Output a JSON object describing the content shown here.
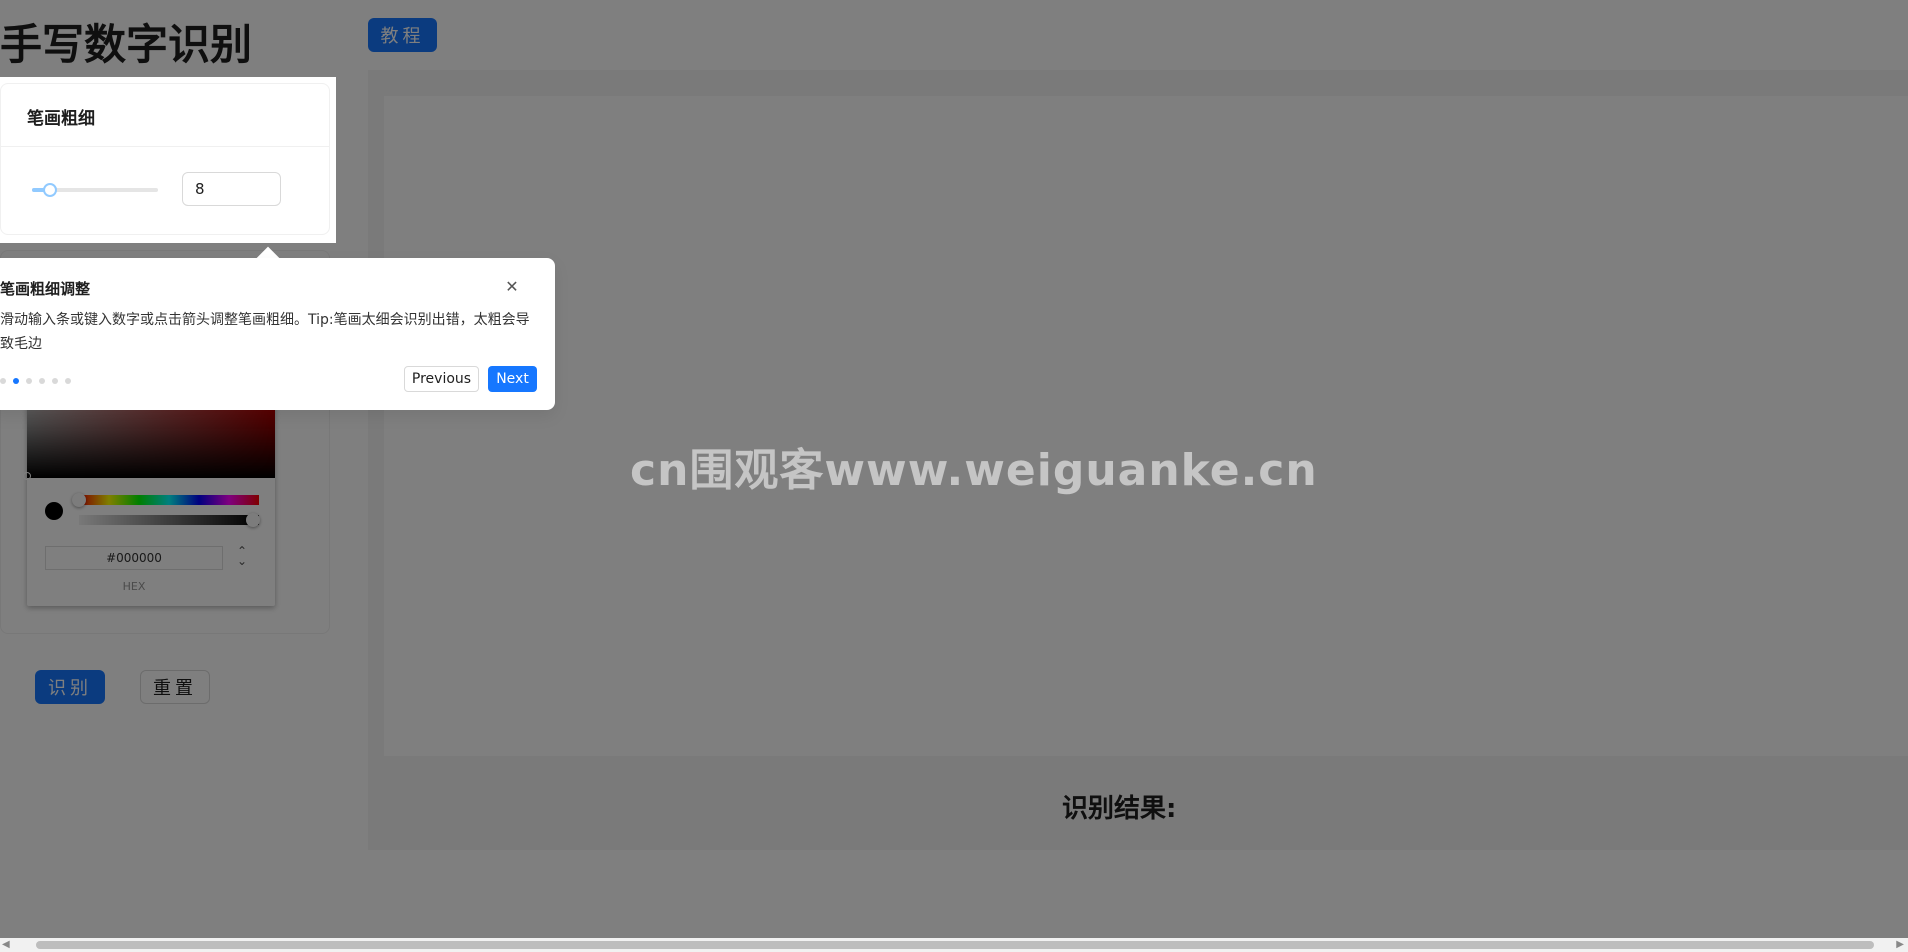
{
  "page": {
    "title": "手写数字识别",
    "tutorial_button": "教程",
    "recognize_button": "识别",
    "reset_button": "重置",
    "result_label": "识别结果:"
  },
  "stroke_card": {
    "title": "笔画粗细",
    "value": "8",
    "slider_fraction": 0.08
  },
  "color_picker": {
    "hex_value": "#000000",
    "mode_label": "HEX",
    "selected_color": "#000000"
  },
  "tour": {
    "title": "笔画粗细调整",
    "description": "滑动输入条或键入数字或点击箭头调整笔画粗细。Tip:笔画太细会识别出错，太粗会导致毛边",
    "prev_label": "Previous",
    "next_label": "Next",
    "total_steps": 6,
    "current_step": 2
  },
  "watermark": "cn围观客www.weiguanke.cn",
  "colors": {
    "primary": "#1677ff",
    "overlay": "rgba(0,0,0,0.5)"
  }
}
